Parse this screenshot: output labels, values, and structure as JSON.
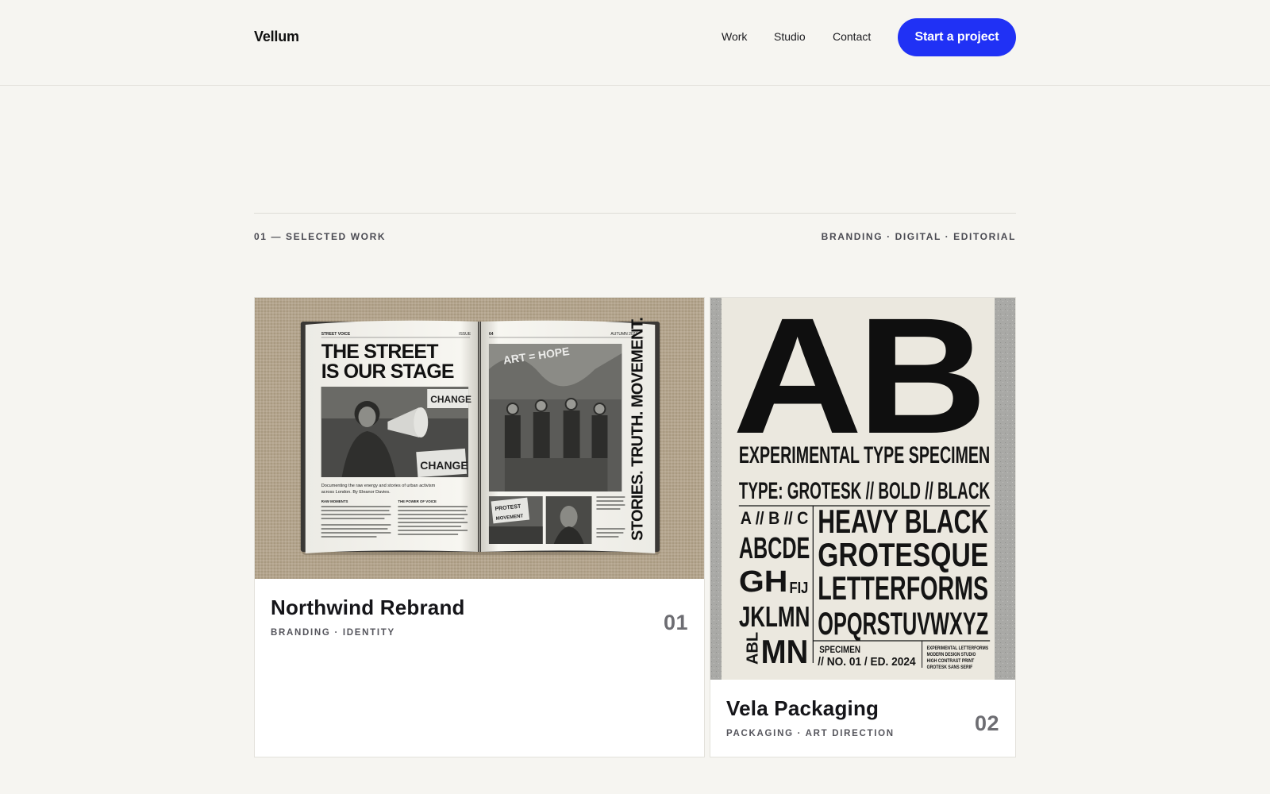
{
  "header": {
    "logo": "Vellum",
    "nav": [
      "Work",
      "Studio",
      "Contact"
    ],
    "cta": "Start a project"
  },
  "section": {
    "eyebrow_left": "01 — SELECTED WORK",
    "eyebrow_right": "BRANDING · DIGITAL · EDITORIAL"
  },
  "colors": {
    "accent": "#2031f5",
    "background": "#f6f5f1",
    "card": "#ffffff"
  },
  "projects": [
    {
      "title": "Northwind Rebrand",
      "tags": "BRANDING · IDENTITY",
      "number": "01",
      "image": {
        "header_left": "STREET VOICE",
        "header_issue": "ISSUE",
        "header_page": "64",
        "header_right": "AUTUMN 2023",
        "headline_1": "THE STREET",
        "headline_2": "IS OUR STAGE",
        "sign_1": "CHANGE",
        "sign_2": "CHANGE",
        "caption": "Documenting the raw energy and stories of urban activism across London. By Eleanor Davies.",
        "col_head_1": "RAW MOMENTS",
        "col_head_2": "THE POWER OF VOICE",
        "mural_text": "ART = HOPE",
        "thumb_sign": "PROTEST TRUTH MOVEMENT",
        "vertical": "STORIES. TRUTH. MOVEMENT."
      }
    },
    {
      "title": "Vela Packaging",
      "tags": "PACKAGING · ART DIRECTION",
      "number": "02",
      "image": {
        "big_letters": "AB",
        "line_1": "EXPERIMENTAL TYPE SPECIMEN",
        "line_2": "TYPE: GROTESK // BOLD // BLACK",
        "small_1": "A // B // C",
        "small_2": "ABCDE",
        "small_3": "GH",
        "small_3b": "FIJ",
        "small_4": "JKLMN",
        "small_5": "ABL",
        "small_5b": "MN",
        "big_1": "HEAVY BLACK",
        "big_2": "GROTESQUE",
        "big_3": "LETTERFORMS",
        "big_4": "OPQRSTUVWXYZ",
        "spec_1": "SPECIMEN",
        "spec_2": "// NO. 01 / ED. 2024",
        "note_1": "EXPERIMENTAL LETTERFORMS",
        "note_2": "MODERN DESIGN STUDIO",
        "note_3": "HIGH CONTRAST PRINT",
        "note_4": "GROTESK SANS SERIF"
      }
    }
  ]
}
